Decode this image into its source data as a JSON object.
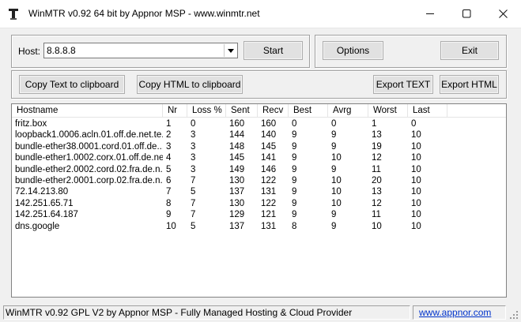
{
  "window": {
    "title": "WinMTR v0.92 64 bit by Appnor MSP - www.winmtr.net"
  },
  "host": {
    "label": "Host:",
    "value": "8.8.8.8"
  },
  "buttons": {
    "start": "Start",
    "options": "Options",
    "exit": "Exit",
    "copy_text": "Copy Text to clipboard",
    "copy_html": "Copy HTML to clipboard",
    "export_text": "Export TEXT",
    "export_html": "Export HTML"
  },
  "table": {
    "columns": [
      "Hostname",
      "Nr",
      "Loss %",
      "Sent",
      "Recv",
      "Best",
      "Avrg",
      "Worst",
      "Last"
    ],
    "rows": [
      [
        "fritz.box",
        "1",
        "0",
        "160",
        "160",
        "0",
        "0",
        "1",
        "0"
      ],
      [
        "loopback1.0006.acln.01.off.de.net.te...",
        "2",
        "3",
        "144",
        "140",
        "9",
        "9",
        "13",
        "10"
      ],
      [
        "bundle-ether38.0001.cord.01.off.de....",
        "3",
        "3",
        "148",
        "145",
        "9",
        "9",
        "19",
        "10"
      ],
      [
        "bundle-ether1.0002.corx.01.off.de.ne...",
        "4",
        "3",
        "145",
        "141",
        "9",
        "10",
        "12",
        "10"
      ],
      [
        "bundle-ether2.0002.cord.02.fra.de.n...",
        "5",
        "3",
        "149",
        "146",
        "9",
        "9",
        "11",
        "10"
      ],
      [
        "bundle-ether2.0001.corp.02.fra.de.n...",
        "6",
        "7",
        "130",
        "122",
        "9",
        "10",
        "20",
        "10"
      ],
      [
        "72.14.213.80",
        "7",
        "5",
        "137",
        "131",
        "9",
        "10",
        "13",
        "10"
      ],
      [
        "142.251.65.71",
        "8",
        "7",
        "130",
        "122",
        "9",
        "10",
        "12",
        "10"
      ],
      [
        "142.251.64.187",
        "9",
        "7",
        "129",
        "121",
        "9",
        "9",
        "11",
        "10"
      ],
      [
        "dns.google",
        "10",
        "5",
        "137",
        "131",
        "8",
        "9",
        "10",
        "10"
      ]
    ]
  },
  "status": {
    "text": "WinMTR v0.92 GPL V2 by Appnor MSP - Fully Managed Hosting & Cloud Provider",
    "link": "www.appnor.com"
  },
  "colors": {
    "window_bg": "#f0f0f0",
    "link": "#0033cc"
  },
  "icons": {
    "app": "winmtr-app-icon",
    "minimize": "minimize-icon",
    "maximize": "maximize-icon",
    "close": "close-icon",
    "dropdown": "chevron-down-icon",
    "grip": "resize-grip-icon"
  }
}
